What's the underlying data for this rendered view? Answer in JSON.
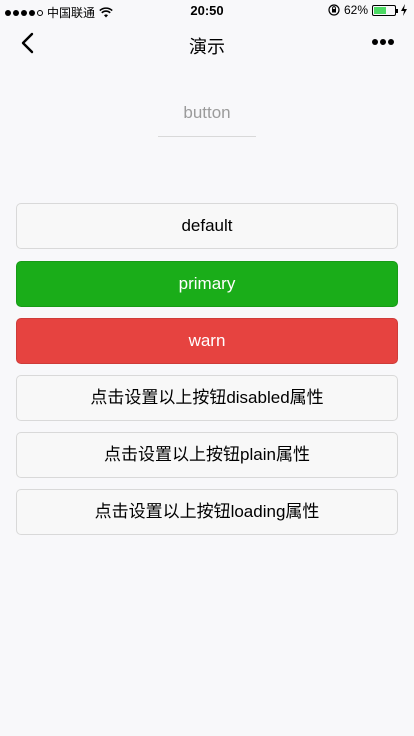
{
  "status_bar": {
    "carrier": "中国联通",
    "time": "20:50",
    "battery_percent": "62%",
    "battery_level": 0.62,
    "colors": {
      "battery": "#4cd964"
    }
  },
  "nav": {
    "title": "演示"
  },
  "page": {
    "label": "button"
  },
  "buttons": [
    {
      "label": "default"
    },
    {
      "label": "primary"
    },
    {
      "label": "warn"
    },
    {
      "label": "点击设置以上按钮disabled属性"
    },
    {
      "label": "点击设置以上按钮plain属性"
    },
    {
      "label": "点击设置以上按钮loading属性"
    }
  ],
  "colors": {
    "primary": "#1aad19",
    "warn": "#e64340",
    "default_bg": "#f8f8f8",
    "page_bg": "#f8f8fa"
  }
}
